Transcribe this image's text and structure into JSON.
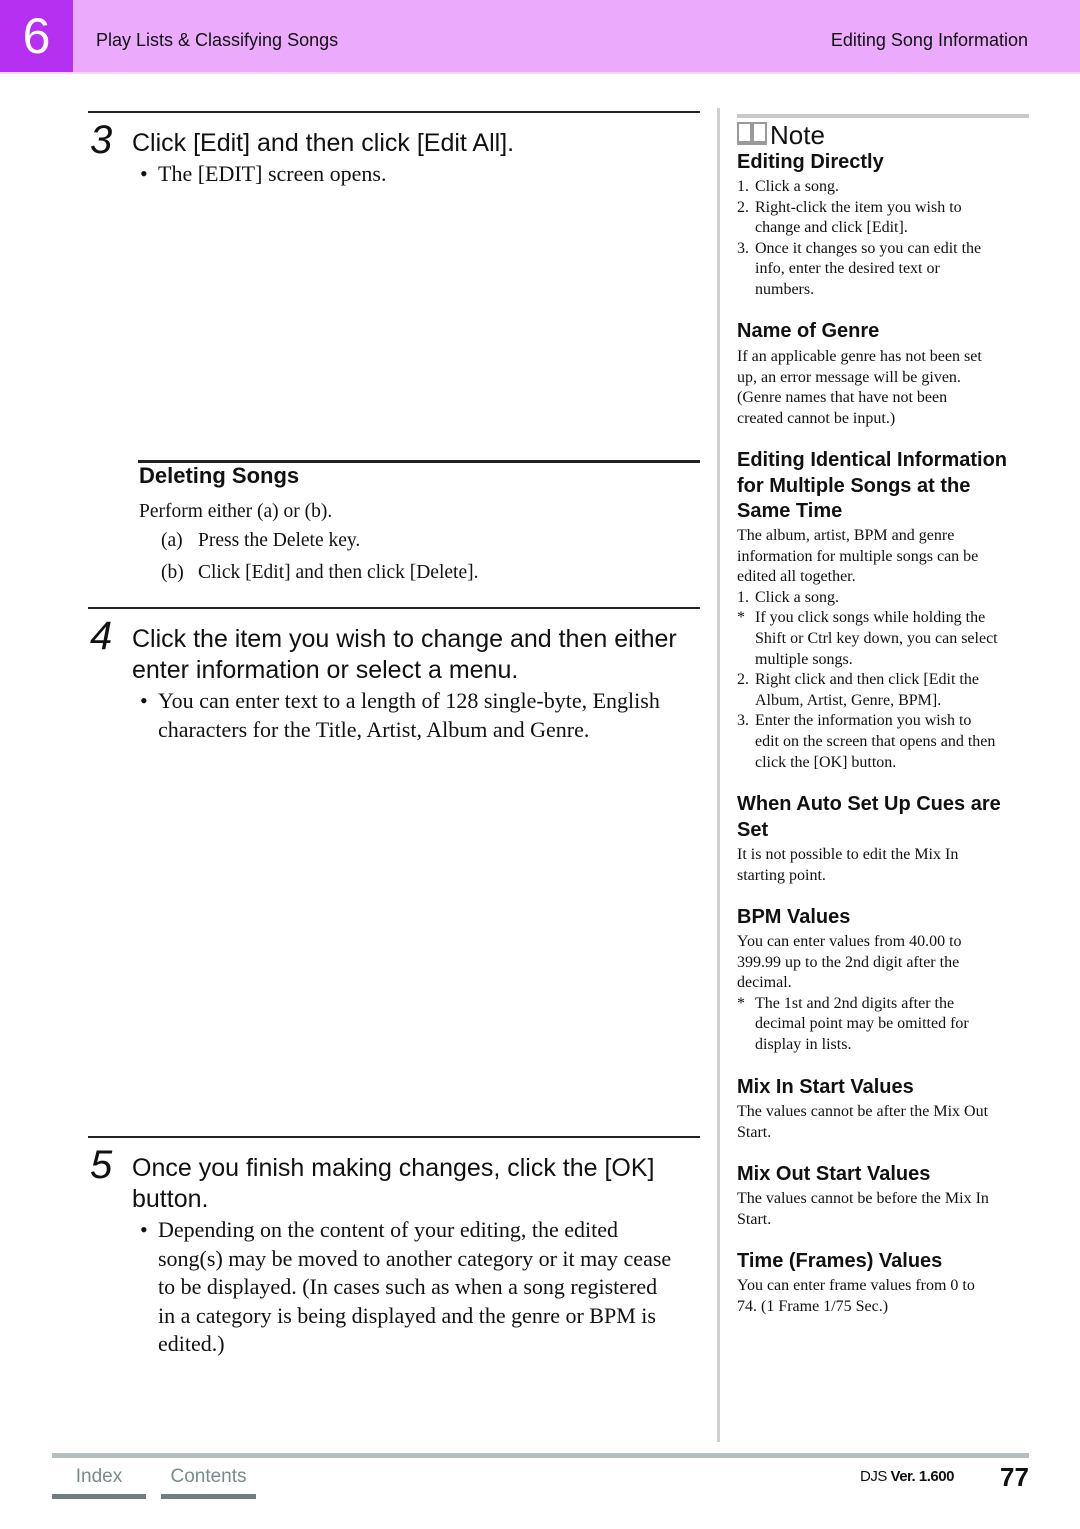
{
  "header": {
    "chapter_number": "6",
    "section": "Play Lists & Classifying Songs",
    "topic": "Editing Song Information",
    "colors": {
      "chapter_box": "#b530f0",
      "band": "#ecaafc"
    }
  },
  "main": {
    "step3": {
      "number": "3",
      "title": "Click [Edit] and then click [Edit All].",
      "bullets": [
        "The [EDIT]  screen opens."
      ]
    },
    "deleting": {
      "title": "Deleting Songs",
      "intro": "Perform either (a) or (b).",
      "options": [
        {
          "label": "(a)",
          "text": "Press the Delete key."
        },
        {
          "label": "(b)",
          "text": "Click [Edit] and then click [Delete]."
        }
      ]
    },
    "step4": {
      "number": "4",
      "title_line1": "Click the item you wish to change and then either",
      "title_line2": "enter information or select a menu.",
      "bullet_line1": "You can enter text to a length of 128 single-byte, English",
      "bullet_line2": "characters for the Title, Artist, Album and Genre."
    },
    "step5": {
      "number": "5",
      "title_line1": "Once you finish making changes, click the [OK]",
      "title_line2": "button.",
      "bullet_lines": [
        "Depending on the content of your editing, the edited",
        "song(s) may be moved to another category or it may cease",
        "to be displayed. (In cases such as when a song registered",
        "in a category is being displayed and the genre or BPM is",
        "edited.)"
      ]
    }
  },
  "note": {
    "label": "Note",
    "icon": "book-icon",
    "sections": {
      "editing_directly": {
        "title": "Editing Directly",
        "items": [
          {
            "marker": "1.",
            "lines": [
              "Click a song."
            ]
          },
          {
            "marker": "2.",
            "lines": [
              "Right-click the item you wish to",
              "change and click [Edit]."
            ]
          },
          {
            "marker": "3.",
            "lines": [
              "Once it changes so you can edit the",
              "info, enter the desired text or",
              "numbers."
            ]
          }
        ]
      },
      "genre": {
        "title": "Name of Genre",
        "lines": [
          "If an applicable genre has not been set",
          "up, an error message will be given.",
          "(Genre names that have not been",
          "created cannot be input.)"
        ]
      },
      "multiple": {
        "title_lines": [
          "Editing Identical Information",
          "for Multiple Songs at the",
          "Same Time"
        ],
        "lines": [
          "The album, artist, BPM and genre",
          "information for multiple songs can be",
          "edited all together."
        ],
        "items": [
          {
            "marker": "1.",
            "lines": [
              "Click a song."
            ]
          },
          {
            "marker": "*",
            "lines": [
              "If you click songs while holding the",
              "Shift or Ctrl key down, you can select",
              "multiple songs."
            ]
          },
          {
            "marker": "2.",
            "lines": [
              "Right click and then click [Edit the",
              "Album, Artist, Genre, BPM]."
            ]
          },
          {
            "marker": "3.",
            "lines": [
              "Enter the information you wish to",
              "edit on the screen that opens and then",
              "click the [OK] button."
            ]
          }
        ]
      },
      "auto_cues": {
        "title_lines": [
          "When Auto Set Up Cues are",
          "Set"
        ],
        "lines": [
          "It is not possible to edit the Mix In",
          "starting point."
        ]
      },
      "bpm": {
        "title": "BPM Values",
        "lines": [
          "You can enter values from 40.00 to",
          "399.99 up to the 2nd digit after the",
          "decimal."
        ],
        "items": [
          {
            "marker": "*",
            "lines": [
              "The 1st and 2nd digits after the",
              "decimal point may be omitted for",
              "display in lists."
            ]
          }
        ]
      },
      "mix_in": {
        "title": "Mix In Start Values",
        "lines": [
          "The values cannot be after the Mix Out",
          "Start."
        ]
      },
      "mix_out": {
        "title": "Mix Out Start Values",
        "lines": [
          "The values cannot be before the Mix In",
          "Start."
        ]
      },
      "frames": {
        "title": "Time (Frames) Values",
        "lines": [
          "You can enter frame values from 0 to",
          "74. (1 Frame   1/75 Sec.)"
        ]
      }
    }
  },
  "footer": {
    "index_label": "Index",
    "contents_label": "Contents",
    "product": "DJS",
    "version_label": "Ver. 1.600",
    "page_number": "77"
  }
}
